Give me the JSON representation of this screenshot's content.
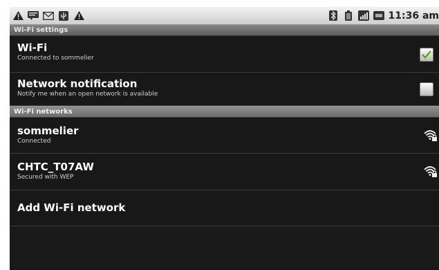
{
  "status_bar": {
    "left_icons": [
      "warning-icon",
      "message-icon",
      "email-icon",
      "usb-icon",
      "warning-icon"
    ],
    "right_icons": [
      "bluetooth-icon",
      "battery-icon",
      "signal-icon",
      "sync-icon"
    ],
    "time": "11:36 am"
  },
  "sections": {
    "wifi_settings": "Wi-Fi settings",
    "wifi_networks": "Wi-Fi networks"
  },
  "settings": {
    "wifi": {
      "title": "Wi-Fi",
      "subtitle": "Connected to sommelier",
      "checked": true
    },
    "notification": {
      "title": "Network notification",
      "subtitle": "Notify me when an open network is available",
      "checked": false
    }
  },
  "networks": [
    {
      "name": "sommelier",
      "status": "Connected",
      "icon": "wifi-locked-icon"
    },
    {
      "name": "CHTC_T07AW",
      "status": "Secured with WEP",
      "icon": "wifi-locked-icon"
    }
  ],
  "add_network": {
    "label": "Add Wi-Fi network"
  }
}
